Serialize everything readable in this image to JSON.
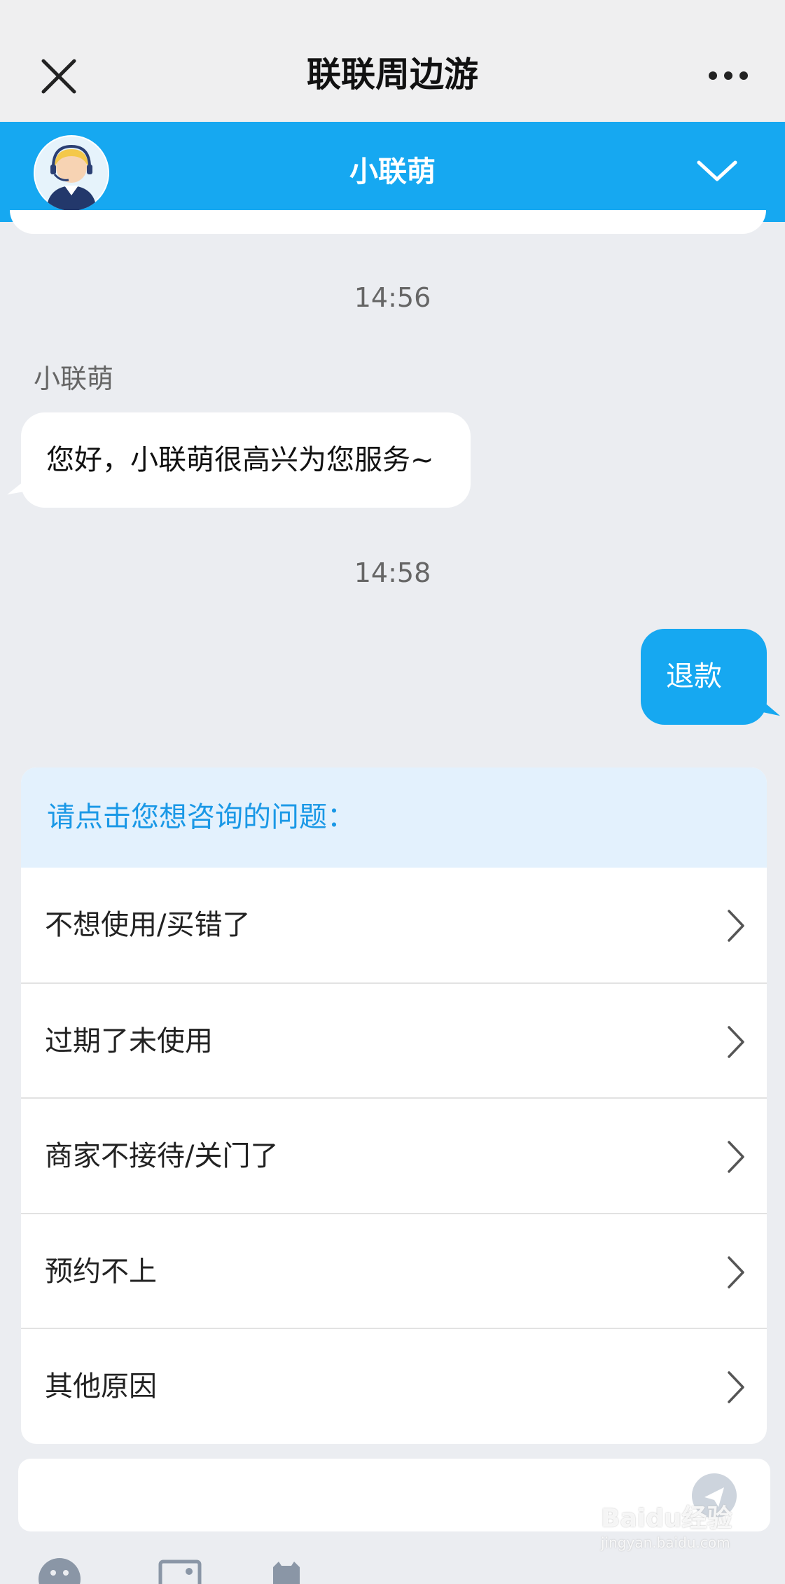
{
  "top_bar": {
    "title": "联联周边游",
    "close_icon": "close-icon",
    "more_icon": "more-icon"
  },
  "agent_bar": {
    "name": "小联萌",
    "avatar_icon": "agent-avatar",
    "collapse_icon": "chevron-down-icon",
    "background": "#16a8f1"
  },
  "chat": {
    "time_1": "14:56",
    "sender": "小联萌",
    "agent_message": "您好，小联萌很高兴为您服务~",
    "time_2": "14:58",
    "user_message": "退款"
  },
  "question_card": {
    "header": "请点击您想咨询的问题：",
    "options": [
      "不想使用/买错了",
      "过期了未使用",
      "商家不接待/关门了",
      "预约不上",
      "其他原因"
    ]
  },
  "composer": {
    "send_icon": "send-icon"
  },
  "toolbar": {
    "icons": [
      "emoji-icon",
      "image-icon",
      "order-icon"
    ]
  },
  "watermark": {
    "brand": "Baidu经验",
    "url": "jingyan.baidu.com"
  },
  "colors": {
    "accent": "#16a8f1",
    "background": "#ebedf1",
    "card_header": "#e3f1fd",
    "card_header_text": "#1a98e6"
  }
}
